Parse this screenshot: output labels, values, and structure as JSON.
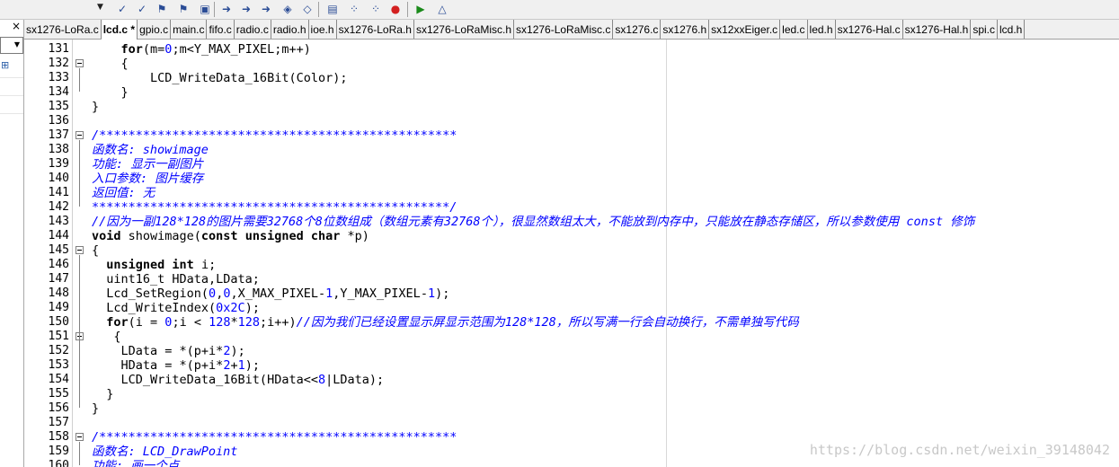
{
  "toolbar": {
    "buttons": [
      "dropdown",
      "build-target",
      "toggle-bookmark",
      "find",
      "find-in-files",
      "incremental-find",
      "debug-session",
      "step-over",
      "step-out",
      "next-bookmark",
      "clear-bookmarks",
      "insert-breakpoint",
      "enable-breakpoint",
      "disable-breakpoint",
      "kill-breakpoints",
      "start-debug",
      "run"
    ]
  },
  "left_panel": {
    "close_glyph": "×",
    "combo_arrow": "▼"
  },
  "tabs": [
    {
      "label": "sx1276-LoRa.c",
      "active": false
    },
    {
      "label": "lcd.c *",
      "active": true
    },
    {
      "label": "gpio.c",
      "active": false
    },
    {
      "label": "main.c",
      "active": false
    },
    {
      "label": "fifo.c",
      "active": false
    },
    {
      "label": "radio.c",
      "active": false
    },
    {
      "label": "radio.h",
      "active": false
    },
    {
      "label": "ioe.h",
      "active": false
    },
    {
      "label": "sx1276-LoRa.h",
      "active": false
    },
    {
      "label": "sx1276-LoRaMisc.h",
      "active": false
    },
    {
      "label": "sx1276-LoRaMisc.c",
      "active": false
    },
    {
      "label": "sx1276.c",
      "active": false
    },
    {
      "label": "sx1276.h",
      "active": false
    },
    {
      "label": "sx12xxEiger.c",
      "active": false
    },
    {
      "label": "led.c",
      "active": false
    },
    {
      "label": "led.h",
      "active": false
    },
    {
      "label": "sx1276-Hal.c",
      "active": false
    },
    {
      "label": "sx1276-Hal.h",
      "active": false
    },
    {
      "label": "spi.c",
      "active": false
    },
    {
      "label": "lcd.h",
      "active": false
    }
  ],
  "editor": {
    "lines": [
      {
        "n": "131",
        "fold": false,
        "segs": [
          [
            "n",
            "    "
          ],
          [
            "kw",
            "for"
          ],
          [
            "n",
            "(m="
          ],
          [
            "num",
            "0"
          ],
          [
            "n",
            ";m<Y_MAX_PIXEL;m++)"
          ]
        ]
      },
      {
        "n": "132",
        "fold": true,
        "segs": [
          [
            "n",
            "    {"
          ]
        ]
      },
      {
        "n": "133",
        "fold": false,
        "segs": [
          [
            "n",
            "        LCD_WriteData_16Bit(Color);"
          ]
        ]
      },
      {
        "n": "134",
        "fold": false,
        "segs": [
          [
            "n",
            "    }"
          ]
        ]
      },
      {
        "n": "135",
        "fold": false,
        "segs": [
          [
            "n",
            "}"
          ]
        ]
      },
      {
        "n": "136",
        "fold": false,
        "segs": []
      },
      {
        "n": "137",
        "fold": true,
        "segs": [
          [
            "cm",
            "/*************************************************"
          ]
        ]
      },
      {
        "n": "138",
        "fold": false,
        "segs": [
          [
            "cm",
            "函数名: showimage"
          ]
        ]
      },
      {
        "n": "139",
        "fold": false,
        "segs": [
          [
            "cm",
            "功能: 显示一副图片"
          ]
        ]
      },
      {
        "n": "140",
        "fold": false,
        "segs": [
          [
            "cm",
            "入口参数: 图片缓存"
          ]
        ]
      },
      {
        "n": "141",
        "fold": false,
        "segs": [
          [
            "cm",
            "返回值: 无"
          ]
        ]
      },
      {
        "n": "142",
        "fold": false,
        "segs": [
          [
            "cm",
            "*************************************************/"
          ]
        ]
      },
      {
        "n": "143",
        "fold": false,
        "segs": [
          [
            "cm",
            "//因为一副128*128的图片需要32768个8位数组成（数组元素有32768个），很显然数组太大，不能放到内存中，只能放在静态存储区，所以参数使用 const 修饰"
          ]
        ]
      },
      {
        "n": "144",
        "fold": false,
        "segs": [
          [
            "kw",
            "void"
          ],
          [
            "n",
            " showimage("
          ],
          [
            "kw",
            "const unsigned char"
          ],
          [
            "n",
            " *p)"
          ]
        ]
      },
      {
        "n": "145",
        "fold": true,
        "segs": [
          [
            "n",
            "{"
          ]
        ]
      },
      {
        "n": "146",
        "fold": false,
        "segs": [
          [
            "n",
            "  "
          ],
          [
            "kw",
            "unsigned int"
          ],
          [
            "n",
            " i;"
          ]
        ]
      },
      {
        "n": "147",
        "fold": false,
        "segs": [
          [
            "n",
            "  uint16_t HData,LData;"
          ]
        ]
      },
      {
        "n": "148",
        "fold": false,
        "segs": [
          [
            "n",
            "  Lcd_SetRegion("
          ],
          [
            "num",
            "0"
          ],
          [
            "n",
            ","
          ],
          [
            "num",
            "0"
          ],
          [
            "n",
            ",X_MAX_PIXEL-"
          ],
          [
            "num",
            "1"
          ],
          [
            "n",
            ",Y_MAX_PIXEL-"
          ],
          [
            "num",
            "1"
          ],
          [
            "n",
            ");"
          ]
        ]
      },
      {
        "n": "149",
        "fold": false,
        "segs": [
          [
            "n",
            "  Lcd_WriteIndex("
          ],
          [
            "num",
            "0x2C"
          ],
          [
            "n",
            ");"
          ]
        ]
      },
      {
        "n": "150",
        "fold": false,
        "segs": [
          [
            "n",
            "  "
          ],
          [
            "kw",
            "for"
          ],
          [
            "n",
            "(i = "
          ],
          [
            "num",
            "0"
          ],
          [
            "n",
            ";i < "
          ],
          [
            "num",
            "128"
          ],
          [
            "n",
            "*"
          ],
          [
            "num",
            "128"
          ],
          [
            "n",
            ";i++)"
          ],
          [
            "cm",
            "//因为我们已经设置显示屏显示范围为128*128，所以写满一行会自动换行，不需单独写代码"
          ]
        ]
      },
      {
        "n": "151",
        "fold": true,
        "segs": [
          [
            "n",
            "   {"
          ]
        ]
      },
      {
        "n": "152",
        "fold": false,
        "segs": [
          [
            "n",
            "    LData = *(p+i*"
          ],
          [
            "num",
            "2"
          ],
          [
            "n",
            ");"
          ]
        ]
      },
      {
        "n": "153",
        "fold": false,
        "segs": [
          [
            "n",
            "    HData = *(p+i*"
          ],
          [
            "num",
            "2"
          ],
          [
            "n",
            "+"
          ],
          [
            "num",
            "1"
          ],
          [
            "n",
            ");"
          ]
        ]
      },
      {
        "n": "154",
        "fold": false,
        "segs": [
          [
            "n",
            "    LCD_WriteData_16Bit(HData<<"
          ],
          [
            "num",
            "8"
          ],
          [
            "n",
            "|LData);"
          ]
        ]
      },
      {
        "n": "155",
        "fold": false,
        "segs": [
          [
            "n",
            "  }"
          ]
        ]
      },
      {
        "n": "156",
        "fold": false,
        "segs": [
          [
            "n",
            "}"
          ]
        ]
      },
      {
        "n": "157",
        "fold": false,
        "segs": []
      },
      {
        "n": "158",
        "fold": true,
        "segs": [
          [
            "cm",
            "/*************************************************"
          ]
        ]
      },
      {
        "n": "159",
        "fold": false,
        "segs": [
          [
            "cm",
            "函数名: LCD_DrawPoint"
          ]
        ]
      },
      {
        "n": "160",
        "fold": false,
        "segs": [
          [
            "cm",
            "功能: 画一个点"
          ]
        ]
      }
    ]
  },
  "watermark": "https://blog.csdn.net/weixin_39148042"
}
